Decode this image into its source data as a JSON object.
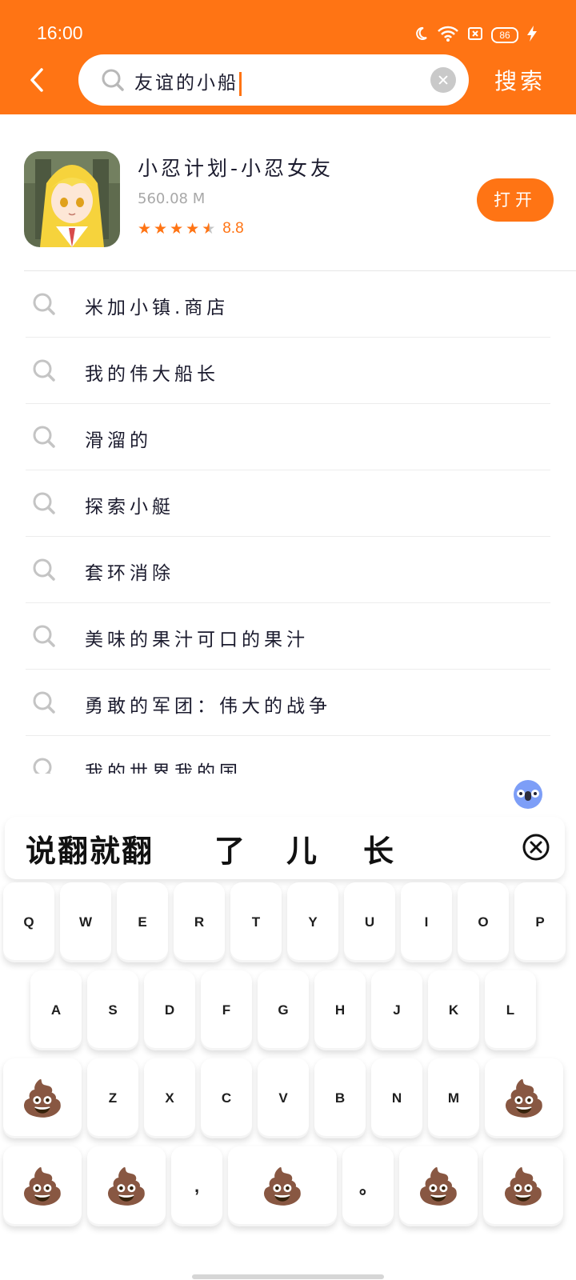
{
  "status": {
    "time": "16:00",
    "battery": "86"
  },
  "search": {
    "query": "友谊的小船",
    "button_label": "搜索"
  },
  "app_result": {
    "name": "小忍计划-小忍女友",
    "size": "560.08 M",
    "rating_value": "8.8",
    "rating_stars": 4.5,
    "open_label": "打开"
  },
  "suggestions": [
    "米加小镇.商店",
    "我的伟大船长",
    "滑溜的",
    "探索小艇",
    "套环消除",
    "美味的果汁可口的果汁",
    "勇敢的军团：伟大的战争",
    "我的世界我的国"
  ],
  "keyboard": {
    "candidates": [
      "说翻就翻",
      "了",
      "儿",
      "长"
    ],
    "rows": [
      [
        "Q",
        "W",
        "E",
        "R",
        "T",
        "Y",
        "U",
        "I",
        "O",
        "P"
      ],
      [
        "A",
        "S",
        "D",
        "F",
        "G",
        "H",
        "J",
        "K",
        "L"
      ],
      [
        "Z",
        "X",
        "C",
        "V",
        "B",
        "N",
        "M"
      ],
      [
        ",",
        "。"
      ]
    ],
    "emoji_key": "💩"
  },
  "colors": {
    "accent": "#ff7414",
    "text": "#1b1b2e",
    "muted": "#a8a8a8"
  },
  "icons": [
    "chevron-left-icon",
    "search-icon",
    "clear-icon",
    "moon-icon",
    "wifi-icon",
    "sim-icon",
    "battery-icon",
    "charging-icon",
    "star-icon",
    "candidate-close-icon",
    "keyboard-logo-icon"
  ]
}
